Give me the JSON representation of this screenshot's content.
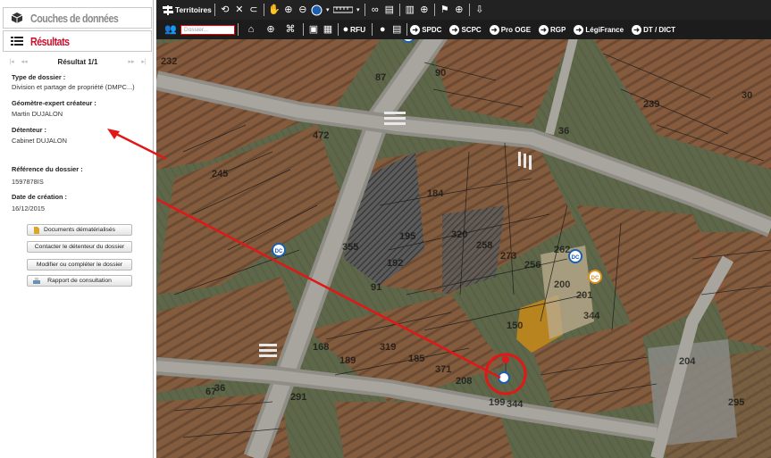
{
  "left_panel": {
    "layers_title": "Couches de données",
    "results_title": "Résultats",
    "pager": {
      "first": "|◂",
      "prev": "◂◂",
      "result_text": "Résultat 1/1",
      "next": "▸▸",
      "last": "▸|"
    },
    "fields": [
      {
        "label": "Type de dossier :",
        "value": "Division et partage de propriété (DMPC...)"
      },
      {
        "label": "Géomètre-expert créateur :",
        "value": "Martin DUJALON"
      },
      {
        "label": "Détenteur :",
        "value": "Cabinet DUJALON"
      },
      {
        "label": "Référence du dossier :",
        "value": "1597878IS"
      },
      {
        "label": "Date de création :",
        "value": "16/12/2015"
      }
    ],
    "buttons": [
      {
        "label": "Documents dématérialisés"
      },
      {
        "label": "Contacter le détenteur du dossier"
      },
      {
        "label": "Modifier ou compléter le dossier"
      },
      {
        "label": "Rapport de consultation"
      }
    ]
  },
  "toolbar": {
    "territoires": "Territoires",
    "dossier_placeholder": "Dossier...",
    "rfu": "RFU",
    "layer_toggles": [
      {
        "label": "SPDC",
        "icon": "arrow-circle-icon"
      },
      {
        "label": "SCPC",
        "icon": "arrow-circle-icon"
      },
      {
        "label": "Pro OGE",
        "icon": "arrow-circle-icon"
      },
      {
        "label": "RGP",
        "icon": "arrow-circle-icon"
      },
      {
        "label": "LégiFrance",
        "icon": "arrow-circle-icon"
      },
      {
        "label": "DT / DICT",
        "icon": "arrow-circle-icon"
      }
    ]
  },
  "map": {
    "parcel_numbers": [
      "232",
      "87",
      "90",
      "239",
      "36",
      "472",
      "30",
      "245",
      "184",
      "355",
      "195",
      "320",
      "258",
      "273",
      "256",
      "262",
      "200",
      "201",
      "344",
      "150",
      "91",
      "192",
      "319",
      "185",
      "371",
      "208",
      "168",
      "189",
      "67",
      "291",
      "199",
      "344",
      "295",
      "204",
      "36"
    ],
    "marker_label": "DC",
    "annotation_color": "#e01818"
  }
}
